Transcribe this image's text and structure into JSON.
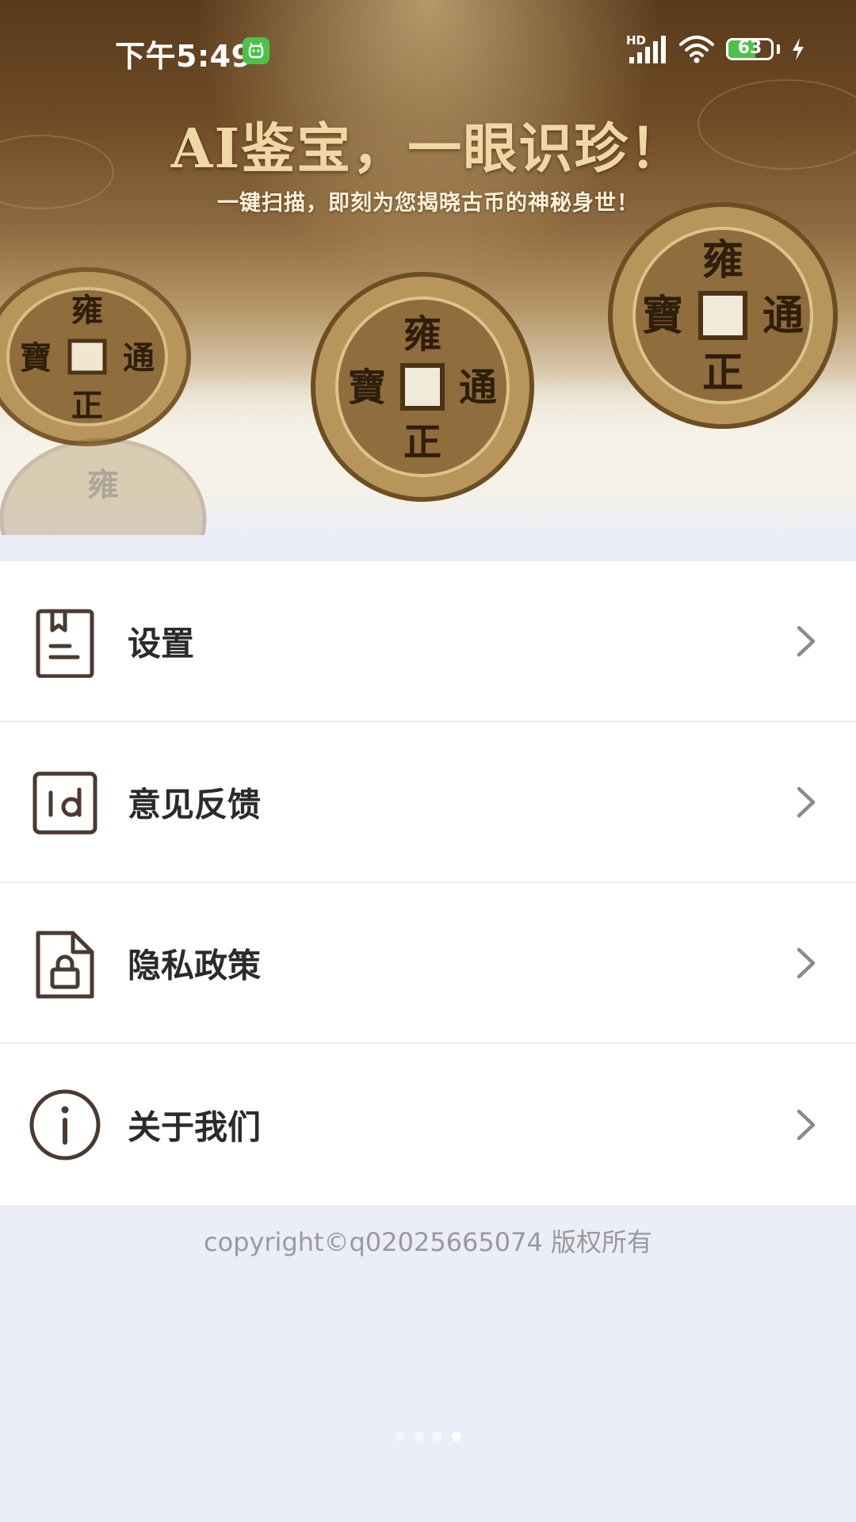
{
  "status_bar": {
    "time": "下午5:49",
    "network_label": "HD",
    "battery_level": "63",
    "battery_fraction": 0.63,
    "icons": [
      "app-notification-icon",
      "signal-icon",
      "wifi-icon",
      "battery-icon",
      "charging-icon"
    ]
  },
  "banner": {
    "title": "AI鉴宝，一眼识珍！",
    "subtitle": "一键扫描，即刻为您揭晓古币的神秘身世！",
    "coin_characters": [
      "雍",
      "正",
      "通",
      "寶"
    ]
  },
  "menu": {
    "items": [
      {
        "label": "设置",
        "icon": "bookmark-document-icon"
      },
      {
        "label": "意见反馈",
        "icon": "feedback-id-icon"
      },
      {
        "label": "隐私政策",
        "icon": "lock-document-icon"
      },
      {
        "label": "关于我们",
        "icon": "info-circle-icon"
      }
    ]
  },
  "footer": {
    "copyright": "copyright©q02025665074 版权所有"
  },
  "page_indicator": {
    "count": 4,
    "active_index": 3
  },
  "colors": {
    "background": "#ebeef8",
    "card": "#ffffff",
    "icon": "#4a3a32",
    "accent_green": "#4cc24a",
    "title_gold": "#f0d7a6"
  }
}
